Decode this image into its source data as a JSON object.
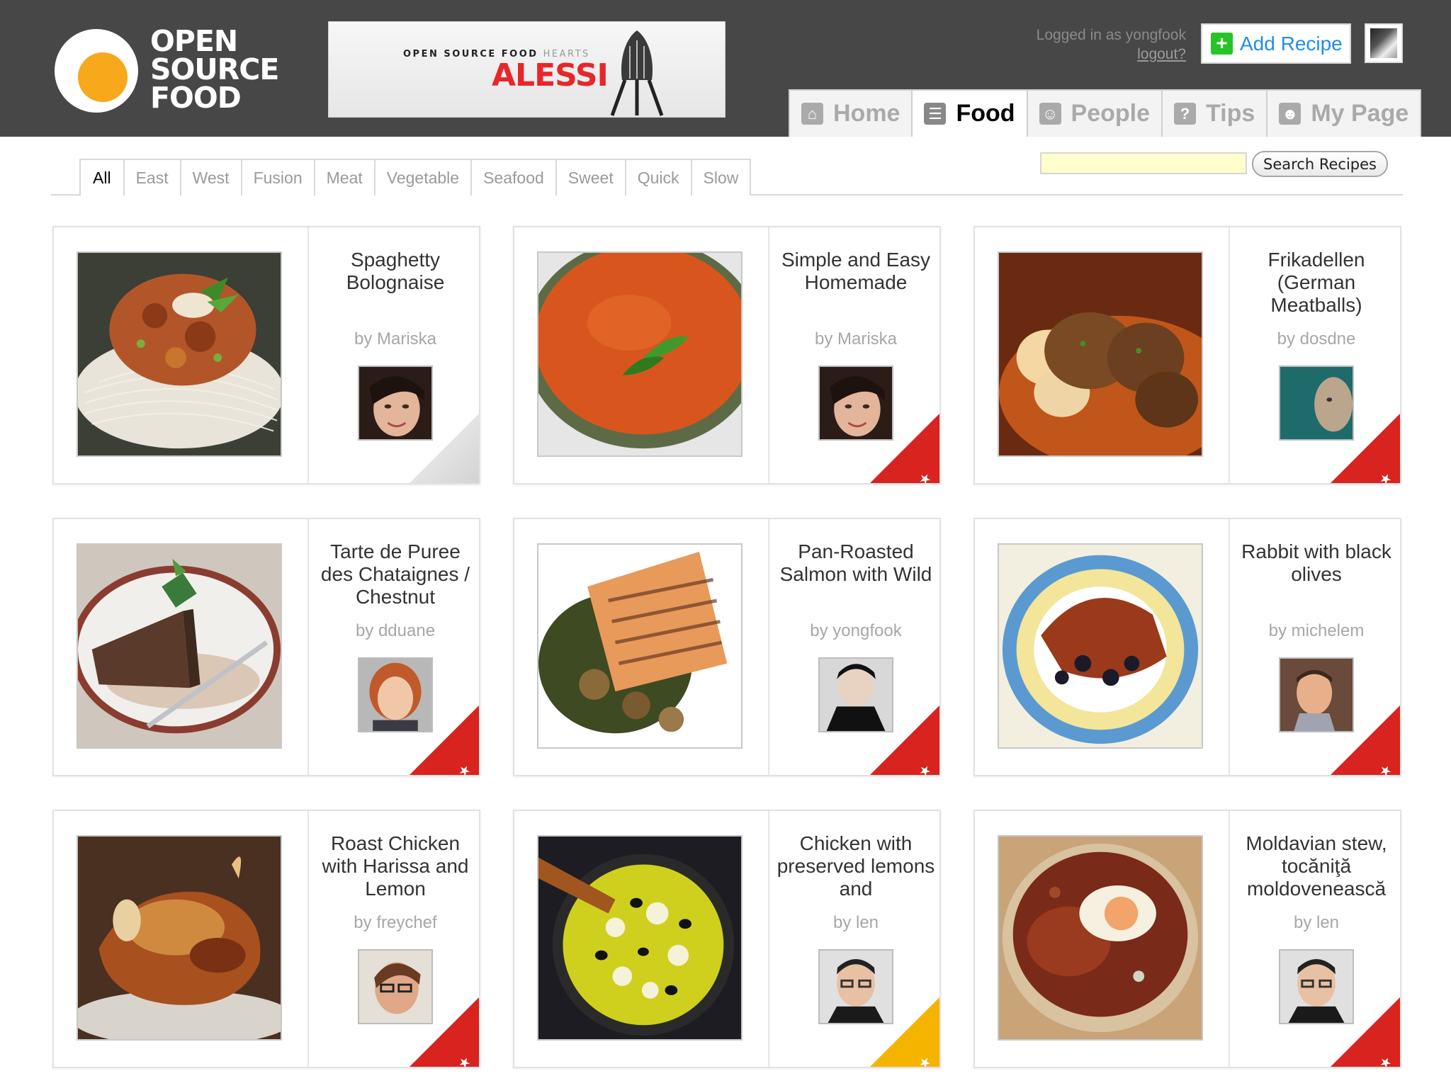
{
  "logo": {
    "line1": "OPEN",
    "line2": "SOURCE",
    "line3": "FOOD"
  },
  "banner": {
    "tagline_dark": "OPEN SOURCE FOOD",
    "tagline_light": "HEARTS",
    "brand": "ALESSI"
  },
  "account": {
    "logged_in_text": "Logged in as yongfook",
    "logout_label": "logout?",
    "add_recipe_label": "Add Recipe"
  },
  "nav": {
    "tabs": [
      {
        "label": "Home",
        "icon": "home-icon",
        "active": false
      },
      {
        "label": "Food",
        "icon": "food-icon",
        "active": true
      },
      {
        "label": "People",
        "icon": "people-icon",
        "active": false
      },
      {
        "label": "Tips",
        "icon": "help-icon",
        "active": false
      },
      {
        "label": "My Page",
        "icon": "user-icon",
        "active": false
      }
    ]
  },
  "filters": [
    "All",
    "East",
    "West",
    "Fusion",
    "Meat",
    "Vegetable",
    "Seafood",
    "Sweet",
    "Quick",
    "Slow"
  ],
  "search": {
    "value": "",
    "button_label": "Search Recipes"
  },
  "recipes": [
    {
      "title": "Spaghetty Bolognaise",
      "byline": "by Mariska",
      "corner": "grey",
      "stars": ""
    },
    {
      "title": "Simple and Easy Homemade",
      "byline": "by Mariska",
      "corner": "red",
      "stars": "★★★"
    },
    {
      "title": "Frikadellen (German Meatballs)",
      "byline": "by dosdne",
      "corner": "red",
      "stars": "★★★"
    },
    {
      "title": "Tarte de Puree des Chataignes / Chestnut",
      "byline": "by dduane",
      "corner": "red",
      "stars": "★★★"
    },
    {
      "title": "Pan-Roasted Salmon with Wild",
      "byline": "by yongfook",
      "corner": "red",
      "stars": "★★★"
    },
    {
      "title": "Rabbit with black olives",
      "byline": "by michelem",
      "corner": "red",
      "stars": "★★★"
    },
    {
      "title": "Roast Chicken with Harissa and Lemon",
      "byline": "by freychef",
      "corner": "red",
      "stars": "★★★"
    },
    {
      "title": "Chicken with preserved lemons and",
      "byline": "by len",
      "corner": "yellow",
      "stars": "★★"
    },
    {
      "title": "Moldavian stew, tocăniţă moldovenească",
      "byline": "by len",
      "corner": "red",
      "stars": "★★★"
    }
  ],
  "colors": {
    "header_bg": "#474747",
    "accent_blue": "#1f8ee8",
    "add_green": "#27c427",
    "rating_red": "#d8231f",
    "rating_yellow": "#f4b400",
    "search_bg": "#ffffce"
  }
}
